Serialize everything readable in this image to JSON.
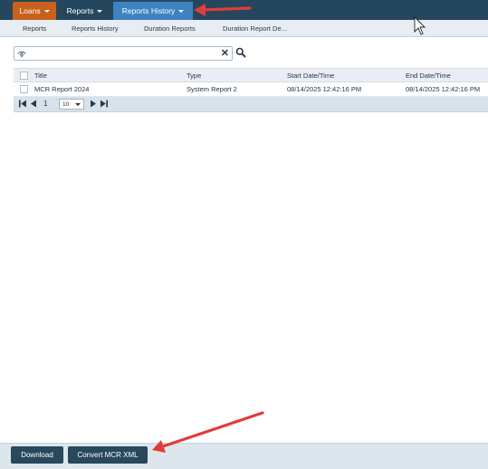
{
  "topnav": {
    "tabs": [
      {
        "label": "Loans"
      },
      {
        "label": "Reports"
      },
      {
        "label": "Reports History"
      }
    ]
  },
  "subnav": {
    "items": [
      {
        "label": "Reports"
      },
      {
        "label": "Reports History"
      },
      {
        "label": "Duration Reports"
      },
      {
        "label": "Duration Report De..."
      }
    ]
  },
  "search": {
    "value": "",
    "placeholder": "",
    "filter_icon": "filter-icon",
    "clear_glyph": "✕",
    "search_icon": "search-icon"
  },
  "grid": {
    "columns": [
      "Title",
      "Type",
      "Start Date/Time",
      "End Date/Time"
    ],
    "rows": [
      {
        "title": "MCR Report 2024",
        "type": "System Report 2",
        "start": "08/14/2025 12:42:16 PM",
        "end": "08/14/2025 12:42:16 PM"
      }
    ]
  },
  "pager": {
    "current_page": "1",
    "page_size": "10"
  },
  "footer": {
    "download_label": "Download",
    "convert_label": "Convert MCR XML"
  },
  "colors": {
    "nav_bg": "#25475d",
    "loans_tab": "#c9611c",
    "active_tab": "#3d82c1",
    "arrow": "#e23b3b",
    "button": "#27485d"
  }
}
